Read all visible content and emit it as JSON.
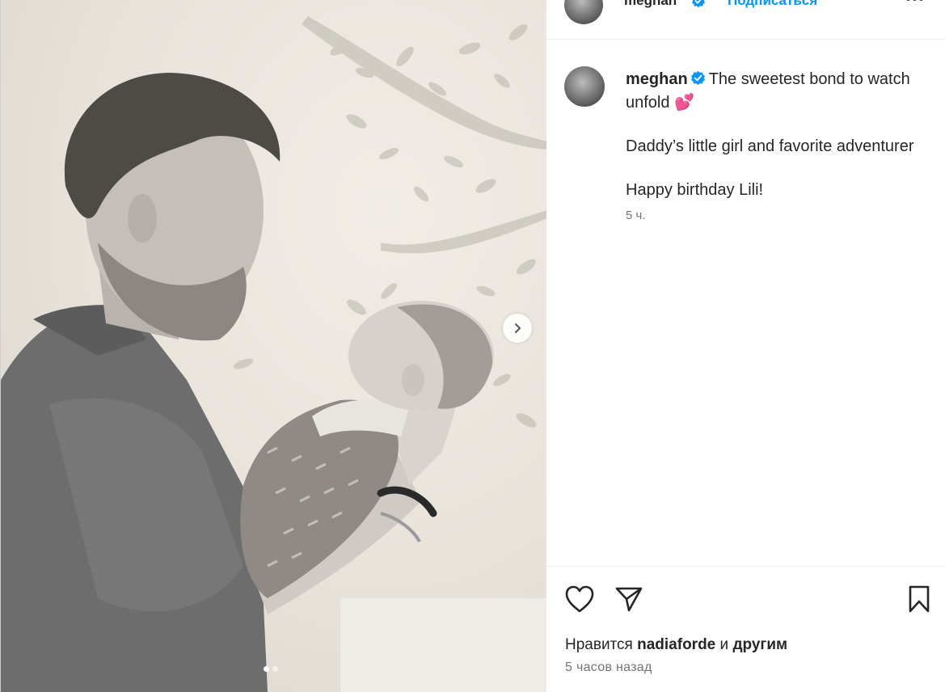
{
  "header": {
    "username": "meghan",
    "follow_label": "Подписаться",
    "more_label": "•••"
  },
  "caption": {
    "username": "meghan",
    "line1": "The sweetest bond to watch unfold",
    "emoji": "💕",
    "line2": "Daddy’s little girl and favorite adventurer",
    "line3": "Happy birthday Lili!",
    "time": "5 ч."
  },
  "media": {
    "next_label": "next-slide",
    "slide_count": 2,
    "active_slide": 1
  },
  "likes": {
    "prefix": "Нравится",
    "user": "nadiaforde",
    "conj": "и",
    "others": "другим"
  },
  "post_time": "5 часов назад",
  "colors": {
    "accent": "#0095f6",
    "verified": "#0095f6",
    "text": "#262626",
    "muted": "#737373"
  },
  "icons": {
    "like": "heart-icon",
    "share": "paper-plane-icon",
    "save": "bookmark-icon",
    "next": "chevron-right-icon",
    "verified": "verified-badge-icon"
  }
}
